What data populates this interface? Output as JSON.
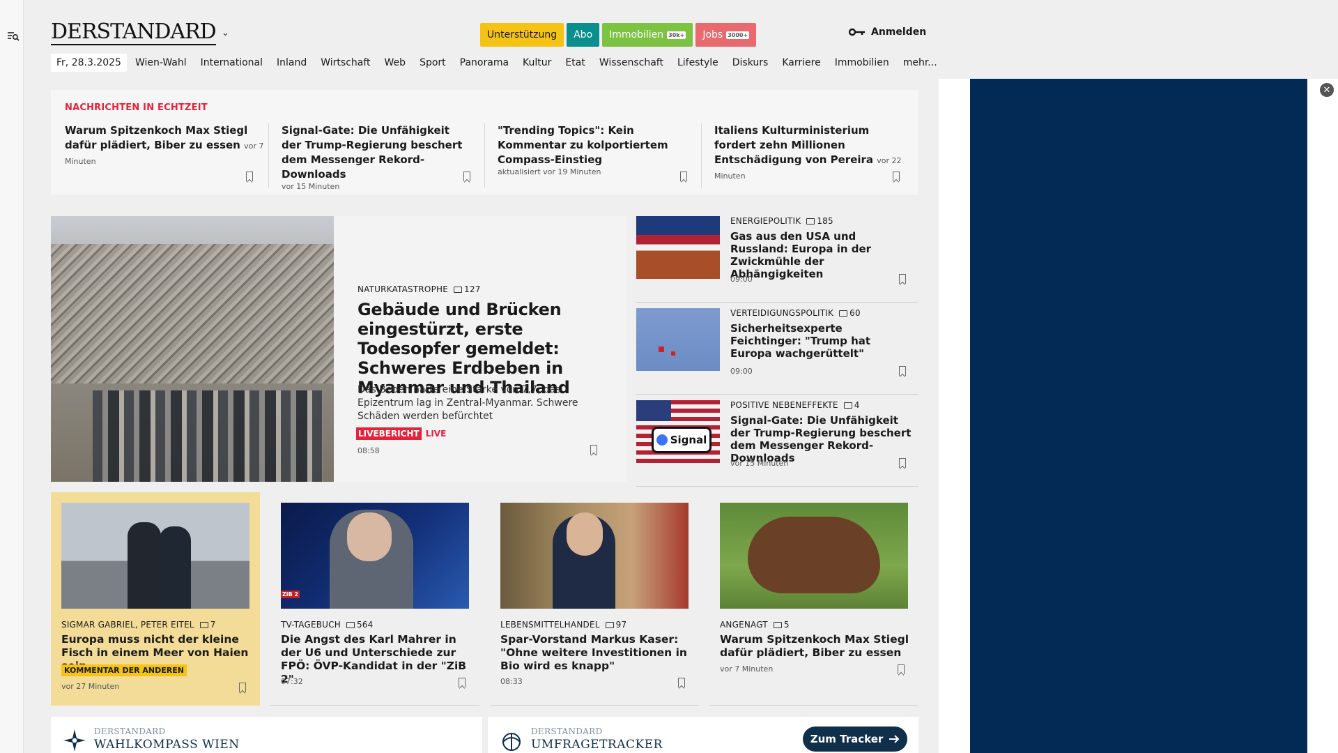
{
  "header": {
    "logo": "DERSTANDARD",
    "pills": [
      {
        "label": "Unterstützung",
        "tag": ""
      },
      {
        "label": "Abo",
        "tag": ""
      },
      {
        "label": "Immobilien",
        "tag": "30k+"
      },
      {
        "label": "Jobs",
        "tag": "3000+"
      }
    ],
    "login": "Anmelden"
  },
  "nav": {
    "date": "Fr, 28.3.2025",
    "items": [
      "Wien-Wahl",
      "International",
      "Inland",
      "Wirtschaft",
      "Web",
      "Sport",
      "Panorama",
      "Kultur",
      "Etat",
      "Wissenschaft",
      "Lifestyle",
      "Diskurs",
      "Karriere",
      "Immobilien",
      "mehr..."
    ]
  },
  "ticker": {
    "title": "NACHRICHTEN IN ECHTZEIT",
    "items": [
      {
        "headline": "Warum Spitzenkoch Max Stiegl dafür plädiert, Biber zu essen",
        "time": "vor 7 Minuten"
      },
      {
        "headline": "Signal-Gate: Die Unfähigkeit der Trump-Regierung beschert dem Messenger Rekord-Downloads",
        "time": "vor 15 Minuten"
      },
      {
        "headline": "\"Trending Topics\": Kein Kommentar zu kolportiertem Compass-Einstieg",
        "time": "aktualisiert vor 19 Minuten"
      },
      {
        "headline": "Italiens Kulturministerium fordert zehn Millionen Entschädigung von Pereira",
        "time": "vor 22 Minuten"
      }
    ]
  },
  "hero": {
    "kicker": "NATURKATASTROPHE",
    "comments": "127",
    "title": "Gebäude und Brücken eingestürzt, erste Todesopfer gemeldet: Schweres Erdbeben in Myanmar und Thailand",
    "teaser": "Das Beben hatte eine Stärke von 7,7, das Epizentrum lag in Zentral-Myanmar. Schwere Schäden werden befürchtet",
    "live_badge": "LIVEBERICHT",
    "live_text": "LIVE",
    "time": "08:58"
  },
  "side": [
    {
      "kicker": "ENERGIEPOLITIK",
      "comments": "185",
      "title": "Gas aus den USA und Russland: Europa in der Zwickmühle der Abhängigkeiten",
      "time": "09:00"
    },
    {
      "kicker": "VERTEIDIGUNGSPOLITIK",
      "comments": "60",
      "title": "Sicherheitsexperte Feichtinger: \"Trump hat Europa wachgerüttelt\"",
      "time": "09:00"
    },
    {
      "kicker": "POSITIVE NEBENEFFEKTE",
      "comments": "4",
      "title": "Signal-Gate: Die Unfähigkeit der Trump-Regierung beschert dem Messenger Rekord-Downloads",
      "time": "vor 15 Minuten",
      "thumb_text": "Signal"
    }
  ],
  "cards": [
    {
      "kicker": "SIGMAR GABRIEL, PETER EITEL",
      "comments": "7",
      "title": "Europa muss nicht der kleine Fisch in einem Meer von Haien sein",
      "badge": "KOMMENTAR DER ANDEREN",
      "time": "vor 27 Minuten"
    },
    {
      "kicker": "TV-TAGEBUCH",
      "comments": "564",
      "title": "Die Angst des Karl Mahrer in der U6 und Unterschiede zur FPÖ: ÖVP-Kandidat in der \"ZiB 2\"",
      "time": "07:32",
      "img_text": "ZiB 2"
    },
    {
      "kicker": "LEBENSMITTELHANDEL",
      "comments": "97",
      "title": "Spar-Vorstand Markus Kaser: \"Ohne weitere Investitionen in Bio wird es knapp\"",
      "time": "08:33"
    },
    {
      "kicker": "ANGENAGT",
      "comments": "5",
      "title": "Warum Spitzenkoch Max Stiegl dafür plädiert, Biber zu essen",
      "time": "vor 7 Minuten"
    }
  ],
  "promos": [
    {
      "brand": "DERSTANDARD",
      "name": "WAHLKOMPASS WIEN"
    },
    {
      "brand": "DERSTANDARD",
      "name": "UMFRAGETRACKER",
      "button": "Zum Tracker"
    }
  ],
  "ad": {
    "close": "✕"
  }
}
